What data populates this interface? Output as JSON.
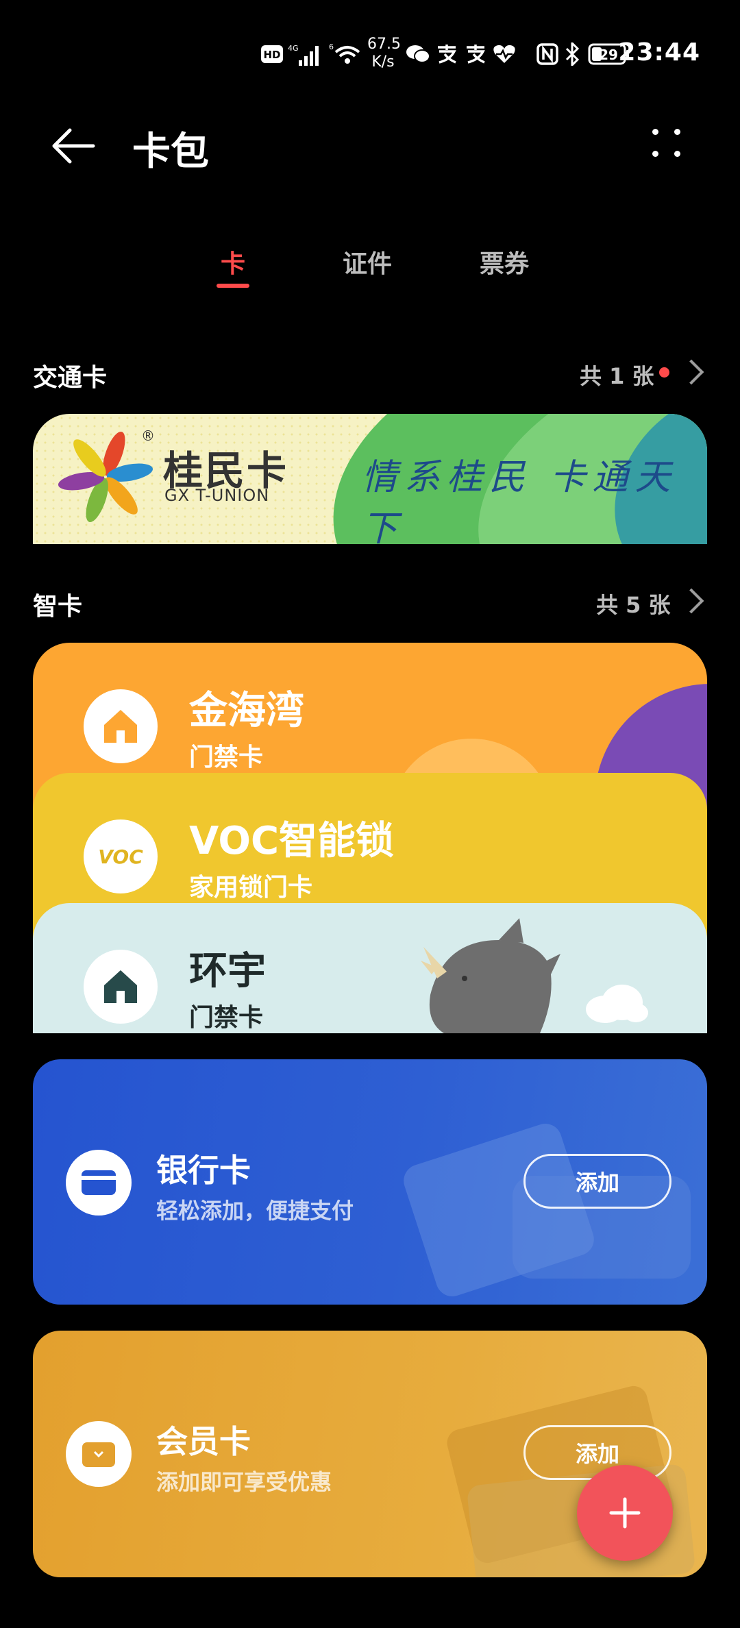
{
  "status_bar": {
    "time": "23:44",
    "network_speed_value": "67.5",
    "network_speed_unit": "K/s",
    "battery": "29",
    "hd_label": "HD",
    "signal_label": "4G",
    "wifi_label": "6",
    "icons": [
      "hd-icon",
      "signal-4g-icon",
      "wifi-icon",
      "wechat-icon",
      "alipay-icon",
      "alipay-icon",
      "health-icon",
      "nfc-icon",
      "bluetooth-icon",
      "battery-icon"
    ]
  },
  "app_bar": {
    "title": "卡包"
  },
  "tabs": [
    {
      "label": "卡",
      "active": true
    },
    {
      "label": "证件",
      "active": false
    },
    {
      "label": "票券",
      "active": false
    }
  ],
  "transit": {
    "section_title": "交通卡",
    "count": "共 1 张",
    "card": {
      "brand": "桂民卡",
      "brand_en": "GX T-UNION",
      "registered": "®",
      "slogan": "情系桂民 卡通天下"
    }
  },
  "smart": {
    "section_title": "智卡",
    "count": "共 5 张",
    "cards": [
      {
        "name": "金海湾",
        "type": "门禁卡",
        "icon": "home-icon",
        "color": "#fda632"
      },
      {
        "name": "VOC智能锁",
        "type": "家用锁门卡",
        "icon": "voc-logo",
        "logo_text": "VOC",
        "color": "#f0c72e"
      },
      {
        "name": "环宇",
        "type": "门禁卡",
        "icon": "home-icon",
        "color": "#d7ecec"
      }
    ]
  },
  "bank": {
    "name": "银行卡",
    "desc": "轻松添加，便捷支付",
    "add_label": "添加",
    "icon": "credit-card-icon",
    "color": "#2554d0"
  },
  "member": {
    "name": "会员卡",
    "desc": "添加即可享受优惠",
    "add_label": "添加",
    "icon": "wallet-icon",
    "color": "#e3a02e"
  },
  "fab": {
    "icon": "plus-icon",
    "color": "#f2535a"
  },
  "colors": {
    "accent": "#ff4b4b",
    "background": "#000000"
  }
}
